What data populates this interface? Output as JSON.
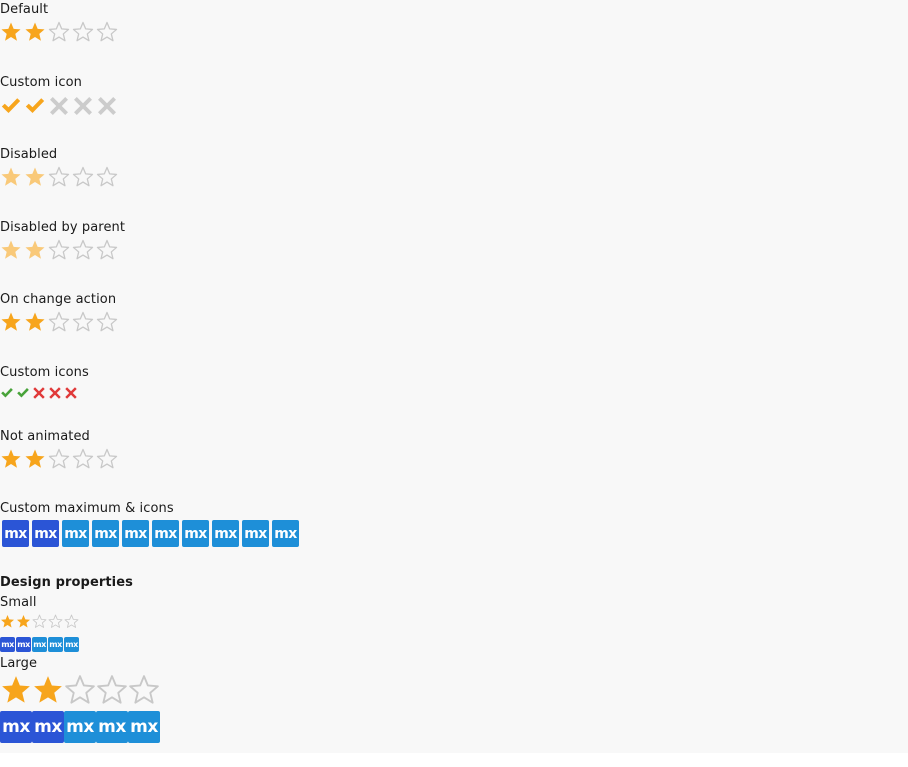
{
  "colors": {
    "star_on": "#f7a51c",
    "star_off": "#c8c8c8",
    "star_disabled_on": "#f9c979",
    "check_on": "#f7a51c",
    "cross_off": "#cccccc",
    "check_green": "#48a33a",
    "cross_red": "#e03a3a",
    "mx_selected": "#2b55d6",
    "mx_unselected": "#1e8fd8"
  },
  "sections": {
    "default": {
      "label": "Default",
      "value": 2,
      "max": 5
    },
    "custom_icon": {
      "label": "Custom icon",
      "value": 2,
      "max": 5
    },
    "disabled": {
      "label": "Disabled",
      "value": 2,
      "max": 5
    },
    "disabled_by_parent": {
      "label": "Disabled by parent",
      "value": 2,
      "max": 5
    },
    "on_change": {
      "label": "On change action",
      "value": 2,
      "max": 5
    },
    "custom_icons": {
      "label": "Custom icons",
      "value": 2,
      "max": 5
    },
    "not_animated": {
      "label": "Not animated",
      "value": 2,
      "max": 5
    },
    "custom_max": {
      "label": "Custom maximum & icons",
      "value": 2,
      "max": 10,
      "icon_text": "mx"
    }
  },
  "design": {
    "heading": "Design properties",
    "small_label": "Small",
    "large_label": "Large",
    "small_stars": {
      "value": 2,
      "max": 5
    },
    "small_mx": {
      "value": 2,
      "max": 5,
      "icon_text": "mx"
    },
    "large_stars": {
      "value": 2,
      "max": 5
    },
    "large_mx": {
      "value": 2,
      "max": 5,
      "icon_text": "mx"
    }
  }
}
